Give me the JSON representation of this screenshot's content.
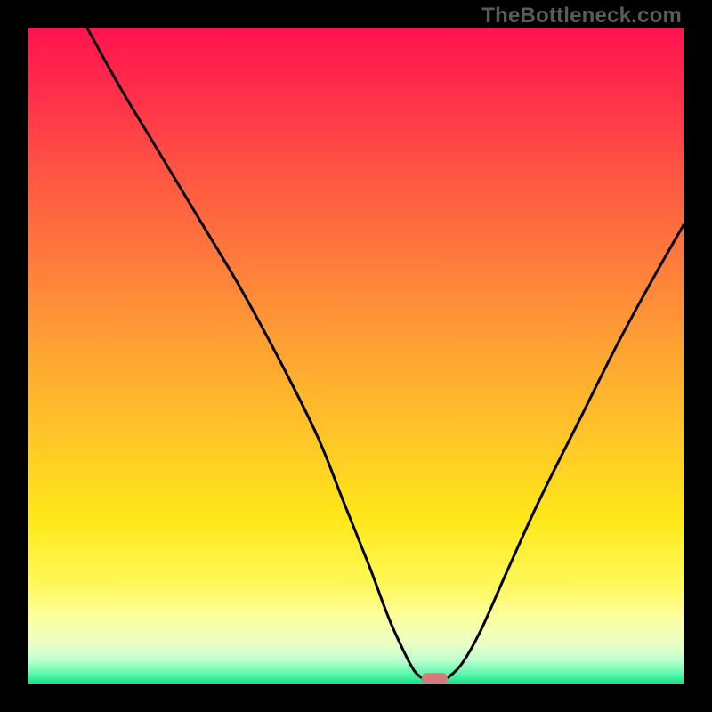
{
  "watermark": "TheBottleneck.com",
  "chart_data": {
    "type": "line",
    "title": "",
    "xlabel": "",
    "ylabel": "",
    "xlim": [
      0,
      100
    ],
    "ylim": [
      0,
      100
    ],
    "background_gradient": {
      "stops": [
        {
          "t": 0.0,
          "color": "#ff1450"
        },
        {
          "t": 0.1,
          "color": "#ff2f4a"
        },
        {
          "t": 0.22,
          "color": "#ff5543"
        },
        {
          "t": 0.35,
          "color": "#ff7a3c"
        },
        {
          "t": 0.48,
          "color": "#ffa033"
        },
        {
          "t": 0.62,
          "color": "#ffc528"
        },
        {
          "t": 0.75,
          "color": "#ffe81a"
        },
        {
          "t": 0.85,
          "color": "#fff85a"
        },
        {
          "t": 0.9,
          "color": "#fcffa0"
        },
        {
          "t": 0.94,
          "color": "#eaffc7"
        },
        {
          "t": 0.965,
          "color": "#bcffd0"
        },
        {
          "t": 0.985,
          "color": "#5cf7aa"
        },
        {
          "t": 1.0,
          "color": "#18df8b"
        }
      ]
    },
    "curve": {
      "x": [
        9,
        14,
        20,
        26,
        32,
        38,
        44,
        48,
        52,
        55,
        57.5,
        59,
        60.5,
        62,
        63.5,
        66,
        69,
        73,
        78,
        84,
        90,
        96,
        100
      ],
      "y": [
        100,
        91,
        81,
        71,
        61,
        50,
        38,
        28,
        18,
        10,
        4.5,
        1.8,
        0.6,
        0.2,
        0.6,
        2.8,
        8,
        17,
        28,
        40,
        52,
        63,
        70
      ]
    },
    "marker": {
      "x": 62,
      "y": 0,
      "w": 4.0,
      "h": 1.6,
      "color": "#d47a7a"
    }
  }
}
